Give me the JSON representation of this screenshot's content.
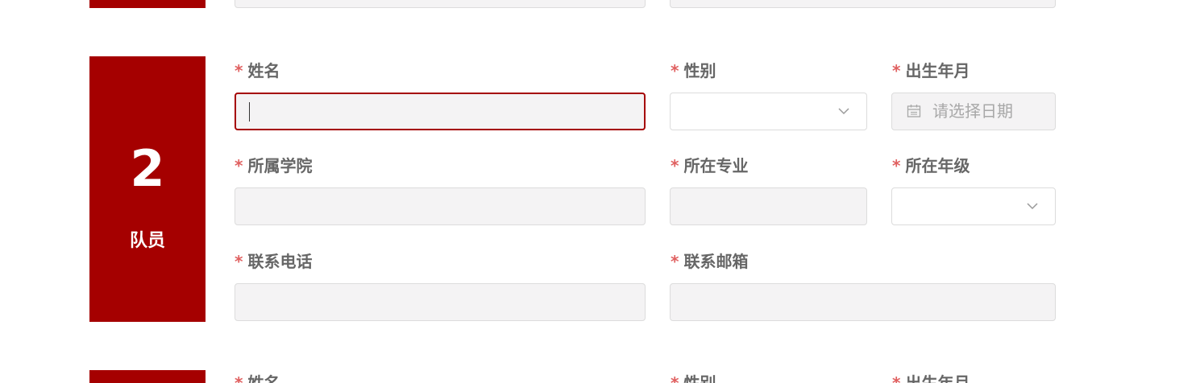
{
  "team_member": {
    "number": "2",
    "role": "队员",
    "required_mark": "*",
    "fields": {
      "name": {
        "label": "姓名",
        "value": ""
      },
      "gender": {
        "label": "性别",
        "value": ""
      },
      "birth_date": {
        "label": "出生年月",
        "placeholder": "请选择日期"
      },
      "college": {
        "label": "所属学院",
        "value": ""
      },
      "major": {
        "label": "所在专业",
        "value": ""
      },
      "grade": {
        "label": "所在年级",
        "value": ""
      },
      "phone": {
        "label": "联系电话",
        "value": ""
      },
      "email": {
        "label": "联系邮箱",
        "value": ""
      }
    }
  },
  "next_member_preview": {
    "required_mark": "*",
    "labels": {
      "name": "姓名",
      "gender": "性别",
      "birth_date": "出生年月"
    }
  },
  "colors": {
    "badge": "#a50000",
    "required": "#e06060",
    "focus_border": "#a50000",
    "input_bg": "#f4f3f4"
  },
  "icons": {
    "select": "chevron-down-icon",
    "date": "calendar-icon"
  }
}
